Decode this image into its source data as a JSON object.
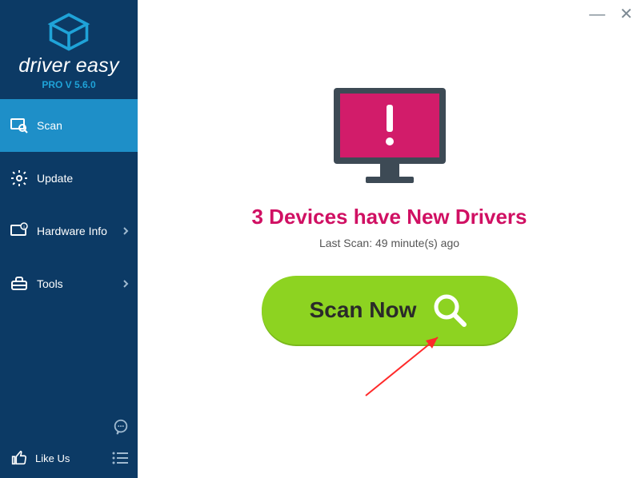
{
  "app": {
    "name": "driver easy",
    "version": "PRO V 5.6.0"
  },
  "nav": {
    "scan": "Scan",
    "update": "Update",
    "hardware": "Hardware Info",
    "tools": "Tools"
  },
  "bottom": {
    "like": "Like Us"
  },
  "main": {
    "status": "3 Devices have New Drivers",
    "last_scan": "Last Scan: 49 minute(s) ago",
    "scan_label": "Scan Now"
  },
  "win": {
    "minimize": "—",
    "close": "✕"
  }
}
